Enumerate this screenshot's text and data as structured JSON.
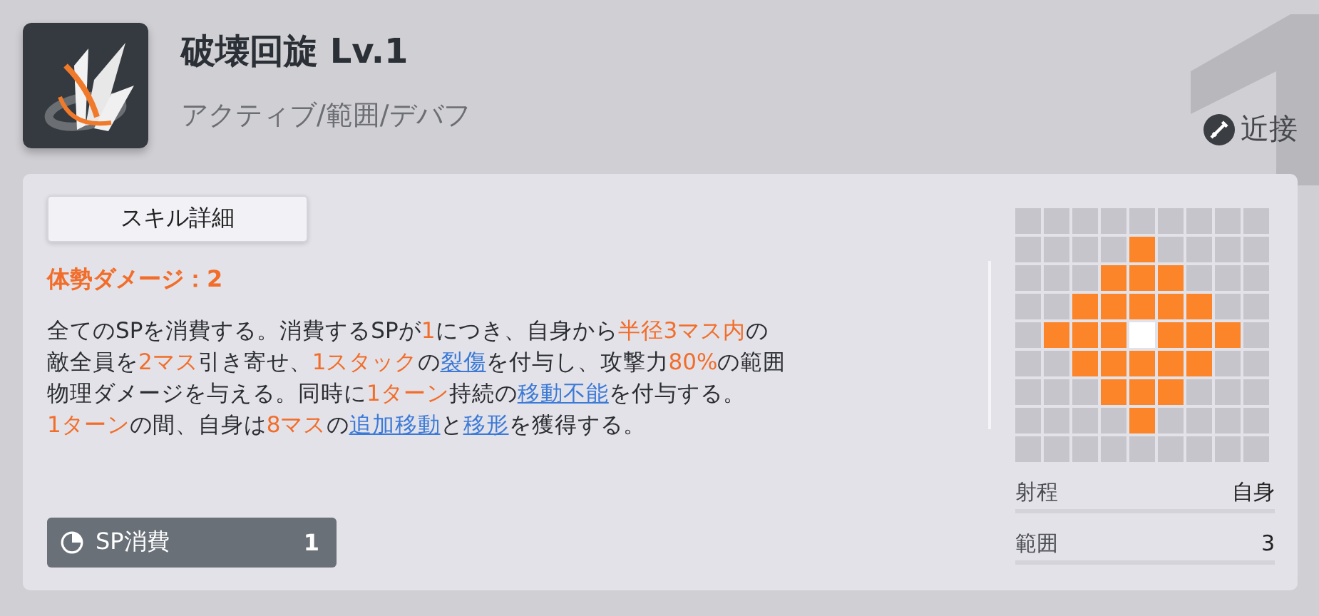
{
  "skill": {
    "name": "破壊回旋 Lv.1",
    "tags": "アクティブ/範囲/デバフ",
    "attack_type": "近接"
  },
  "details_button": "スキル詳細",
  "posture_damage": "体勢ダメージ：2",
  "description": [
    [
      {
        "text": "全てのSPを消費する。消費するSPが",
        "kind": "plain"
      },
      {
        "text": "1",
        "kind": "highlight"
      },
      {
        "text": "につき、自身から",
        "kind": "plain"
      },
      {
        "text": "半径3マス内",
        "kind": "highlight"
      },
      {
        "text": "の",
        "kind": "plain"
      }
    ],
    [
      {
        "text": "敵全員を",
        "kind": "plain"
      },
      {
        "text": "2マス",
        "kind": "highlight"
      },
      {
        "text": "引き寄せ、",
        "kind": "plain"
      },
      {
        "text": "1スタック",
        "kind": "highlight"
      },
      {
        "text": "の",
        "kind": "plain"
      },
      {
        "text": "裂傷",
        "kind": "link"
      },
      {
        "text": "を付与し、攻撃力",
        "kind": "plain"
      },
      {
        "text": "80%",
        "kind": "highlight"
      },
      {
        "text": "の範囲",
        "kind": "plain"
      }
    ],
    [
      {
        "text": "物理ダメージを与える。同時に",
        "kind": "plain"
      },
      {
        "text": "1ターン",
        "kind": "highlight"
      },
      {
        "text": "持続の",
        "kind": "plain"
      },
      {
        "text": "移動不能",
        "kind": "link"
      },
      {
        "text": "を付与する。",
        "kind": "plain"
      }
    ],
    [
      {
        "text": "1ターン",
        "kind": "highlight"
      },
      {
        "text": "の間、自身は",
        "kind": "plain"
      },
      {
        "text": "8マス",
        "kind": "highlight"
      },
      {
        "text": "の",
        "kind": "plain"
      },
      {
        "text": "追加移動",
        "kind": "link"
      },
      {
        "text": "と",
        "kind": "plain"
      },
      {
        "text": "移形",
        "kind": "link"
      },
      {
        "text": "を獲得する。",
        "kind": "plain"
      }
    ]
  ],
  "sp_cost": {
    "label": "SP消費",
    "value": "1"
  },
  "range_grid": [
    [
      {
        "kind": "empty"
      },
      {
        "kind": "empty"
      },
      {
        "kind": "empty"
      },
      {
        "kind": "empty"
      },
      {
        "kind": "empty"
      },
      {
        "kind": "empty"
      },
      {
        "kind": "empty"
      },
      {
        "kind": "empty"
      },
      {
        "kind": "empty"
      }
    ],
    [
      {
        "kind": "empty"
      },
      {
        "kind": "empty"
      },
      {
        "kind": "empty"
      },
      {
        "kind": "empty"
      },
      {
        "kind": "area"
      },
      {
        "kind": "empty"
      },
      {
        "kind": "empty"
      },
      {
        "kind": "empty"
      },
      {
        "kind": "empty"
      }
    ],
    [
      {
        "kind": "empty"
      },
      {
        "kind": "empty"
      },
      {
        "kind": "empty"
      },
      {
        "kind": "area"
      },
      {
        "kind": "area"
      },
      {
        "kind": "area"
      },
      {
        "kind": "empty"
      },
      {
        "kind": "empty"
      },
      {
        "kind": "empty"
      }
    ],
    [
      {
        "kind": "empty"
      },
      {
        "kind": "empty"
      },
      {
        "kind": "area"
      },
      {
        "kind": "area"
      },
      {
        "kind": "area"
      },
      {
        "kind": "area"
      },
      {
        "kind": "area"
      },
      {
        "kind": "empty"
      },
      {
        "kind": "empty"
      }
    ],
    [
      {
        "kind": "empty"
      },
      {
        "kind": "area"
      },
      {
        "kind": "area"
      },
      {
        "kind": "area"
      },
      {
        "kind": "self"
      },
      {
        "kind": "area"
      },
      {
        "kind": "area"
      },
      {
        "kind": "area"
      },
      {
        "kind": "empty"
      }
    ],
    [
      {
        "kind": "empty"
      },
      {
        "kind": "empty"
      },
      {
        "kind": "area"
      },
      {
        "kind": "area"
      },
      {
        "kind": "area"
      },
      {
        "kind": "area"
      },
      {
        "kind": "area"
      },
      {
        "kind": "empty"
      },
      {
        "kind": "empty"
      }
    ],
    [
      {
        "kind": "empty"
      },
      {
        "kind": "empty"
      },
      {
        "kind": "empty"
      },
      {
        "kind": "area"
      },
      {
        "kind": "area"
      },
      {
        "kind": "area"
      },
      {
        "kind": "empty"
      },
      {
        "kind": "empty"
      },
      {
        "kind": "empty"
      }
    ],
    [
      {
        "kind": "empty"
      },
      {
        "kind": "empty"
      },
      {
        "kind": "empty"
      },
      {
        "kind": "empty"
      },
      {
        "kind": "area"
      },
      {
        "kind": "empty"
      },
      {
        "kind": "empty"
      },
      {
        "kind": "empty"
      },
      {
        "kind": "empty"
      }
    ],
    [
      {
        "kind": "empty"
      },
      {
        "kind": "empty"
      },
      {
        "kind": "empty"
      },
      {
        "kind": "empty"
      },
      {
        "kind": "empty"
      },
      {
        "kind": "empty"
      },
      {
        "kind": "empty"
      },
      {
        "kind": "empty"
      },
      {
        "kind": "empty"
      }
    ]
  ],
  "stats": [
    {
      "label": "射程",
      "value": "自身"
    },
    {
      "label": "範囲",
      "value": "3"
    }
  ]
}
